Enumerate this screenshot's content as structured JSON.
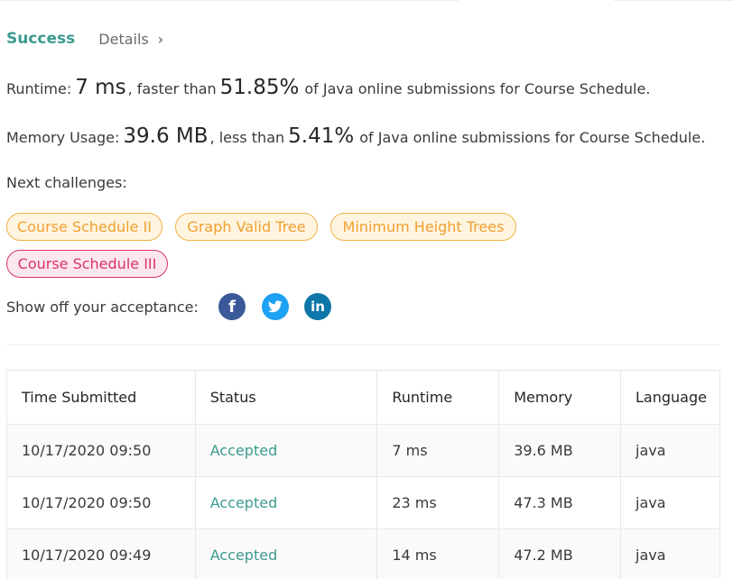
{
  "result": {
    "status": "Success",
    "details_label": "Details"
  },
  "runtime": {
    "label": "Runtime:",
    "value": "7 ms",
    "comparison": ", faster than",
    "percent": "51.85%",
    "suffix": "of Java online submissions for Course Schedule."
  },
  "memory": {
    "label": "Memory Usage:",
    "value": "39.6 MB",
    "comparison": ", less than",
    "percent": "5.41%",
    "suffix": "of Java online submissions for Course Schedule."
  },
  "next_challenges": {
    "label": "Next challenges:",
    "items": [
      {
        "label": "Course Schedule II",
        "difficulty": "medium"
      },
      {
        "label": "Graph Valid Tree",
        "difficulty": "medium"
      },
      {
        "label": "Minimum Height Trees",
        "difficulty": "medium"
      },
      {
        "label": "Course Schedule III",
        "difficulty": "hard"
      }
    ]
  },
  "share": {
    "label": "Show off your acceptance:",
    "icons": [
      "facebook-icon",
      "twitter-icon",
      "linkedin-icon"
    ],
    "facebook_glyph": "f",
    "linkedin_glyph": "in"
  },
  "submissions": {
    "headers": [
      "Time Submitted",
      "Status",
      "Runtime",
      "Memory",
      "Language"
    ],
    "rows": [
      [
        "10/17/2020 09:50",
        "Accepted",
        "7 ms",
        "39.6 MB",
        "java"
      ],
      [
        "10/17/2020 09:50",
        "Accepted",
        "23 ms",
        "47.3 MB",
        "java"
      ],
      [
        "10/17/2020 09:49",
        "Accepted",
        "14 ms",
        "47.2 MB",
        "java"
      ]
    ]
  },
  "colors": {
    "success": "#3c9a8f",
    "medium_tag": "#f0a030",
    "hard_tag": "#d6336c",
    "facebook": "#3b5998",
    "twitter": "#1da1f2",
    "linkedin": "#0e76a8"
  }
}
